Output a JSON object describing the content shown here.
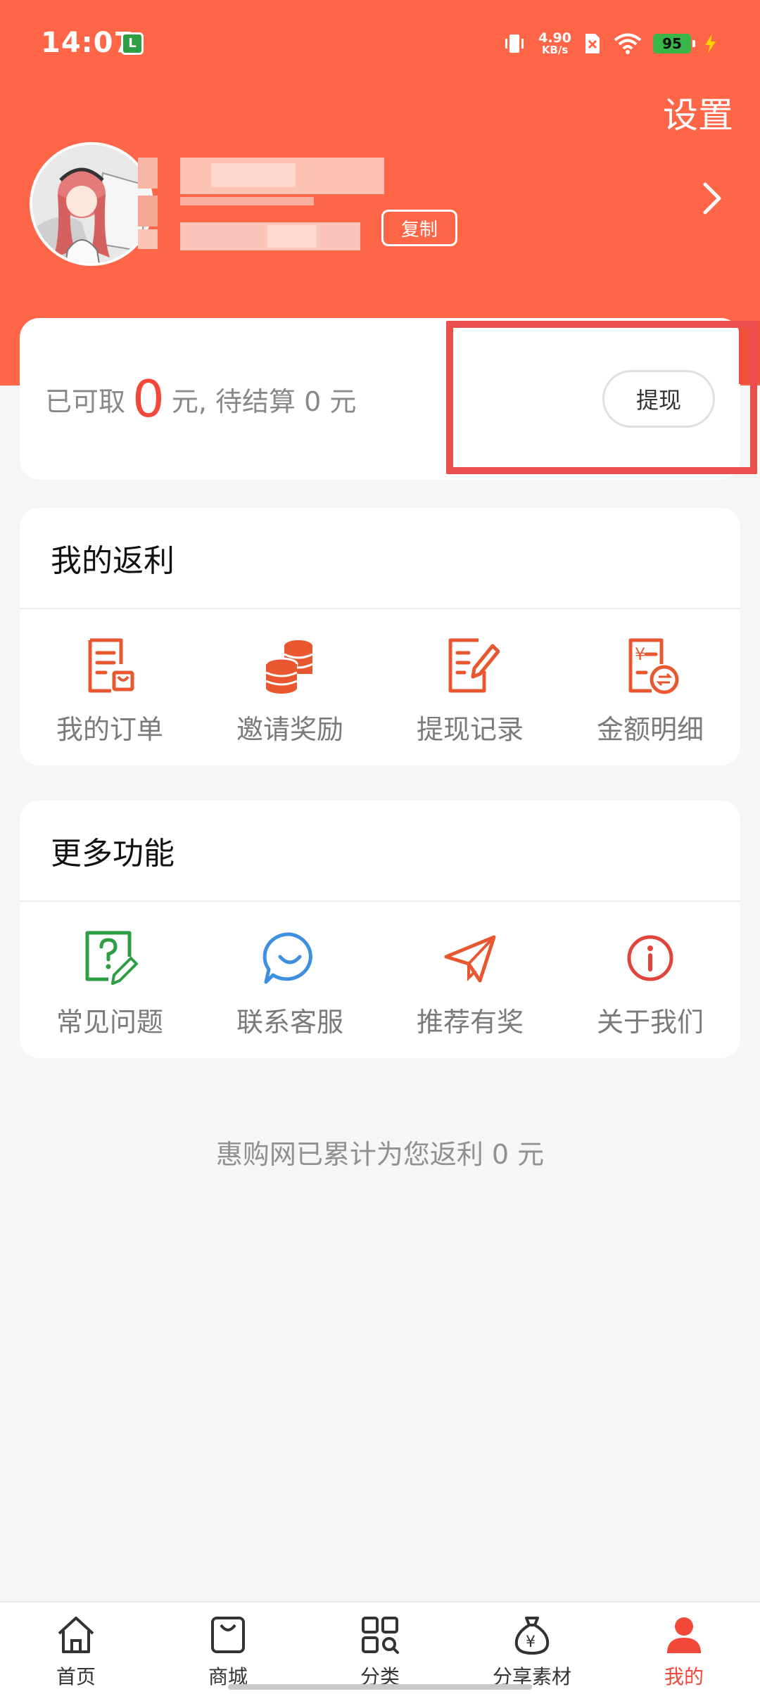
{
  "status_bar": {
    "time": "14:07",
    "app_badge": "L",
    "net_speed_value": "4.90",
    "net_speed_unit": "KB/s",
    "battery": "95"
  },
  "header": {
    "settings_label": "设置",
    "copy_label": "复制"
  },
  "earnings": {
    "prefix": "已可取",
    "amount": "0",
    "suffix": "元,  待结算 0 元",
    "withdraw_label": "提现"
  },
  "rebate_section": {
    "title": "我的返利",
    "items": [
      {
        "label": "我的订单",
        "icon": "order-icon"
      },
      {
        "label": "邀请奖励",
        "icon": "coins-icon"
      },
      {
        "label": "提现记录",
        "icon": "withdraw-record-icon"
      },
      {
        "label": "金额明细",
        "icon": "amount-detail-icon"
      }
    ]
  },
  "more_section": {
    "title": "更多功能",
    "items": [
      {
        "label": "常见问题",
        "icon": "faq-icon"
      },
      {
        "label": "联系客服",
        "icon": "customer-service-icon"
      },
      {
        "label": "推荐有奖",
        "icon": "paper-plane-icon"
      },
      {
        "label": "关于我们",
        "icon": "info-icon"
      }
    ]
  },
  "total_text": "惠购网已累计为您返利 0 元",
  "bottom_nav": {
    "items": [
      {
        "label": "首页",
        "icon": "home-icon"
      },
      {
        "label": "商城",
        "icon": "shopping-bag-icon"
      },
      {
        "label": "分类",
        "icon": "category-icon"
      },
      {
        "label": "分享素材",
        "icon": "money-bag-icon"
      },
      {
        "label": "我的",
        "icon": "user-icon"
      }
    ],
    "active_index": 4
  },
  "colors": {
    "primary": "#ff6547",
    "accent_red": "#f2483a",
    "icon_orange": "#e8572f",
    "faq_green": "#2e9e45",
    "service_blue": "#3d8fe0",
    "info_red": "#e0443c"
  }
}
